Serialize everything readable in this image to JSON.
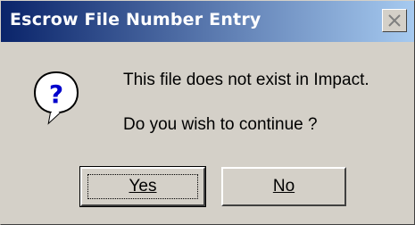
{
  "window": {
    "title": "Escrow File Number Entry",
    "close_icon": "close-icon"
  },
  "message": {
    "icon": "question-icon",
    "line1": "This file does not exist in Impact.",
    "line2": "Do you wish to continue ?"
  },
  "buttons": {
    "yes_label": "Yes",
    "no_label": "No"
  },
  "colors": {
    "titlebar_start": "#0a246a",
    "titlebar_end": "#a6caf0",
    "dialog_face": "#d4d0c8"
  }
}
